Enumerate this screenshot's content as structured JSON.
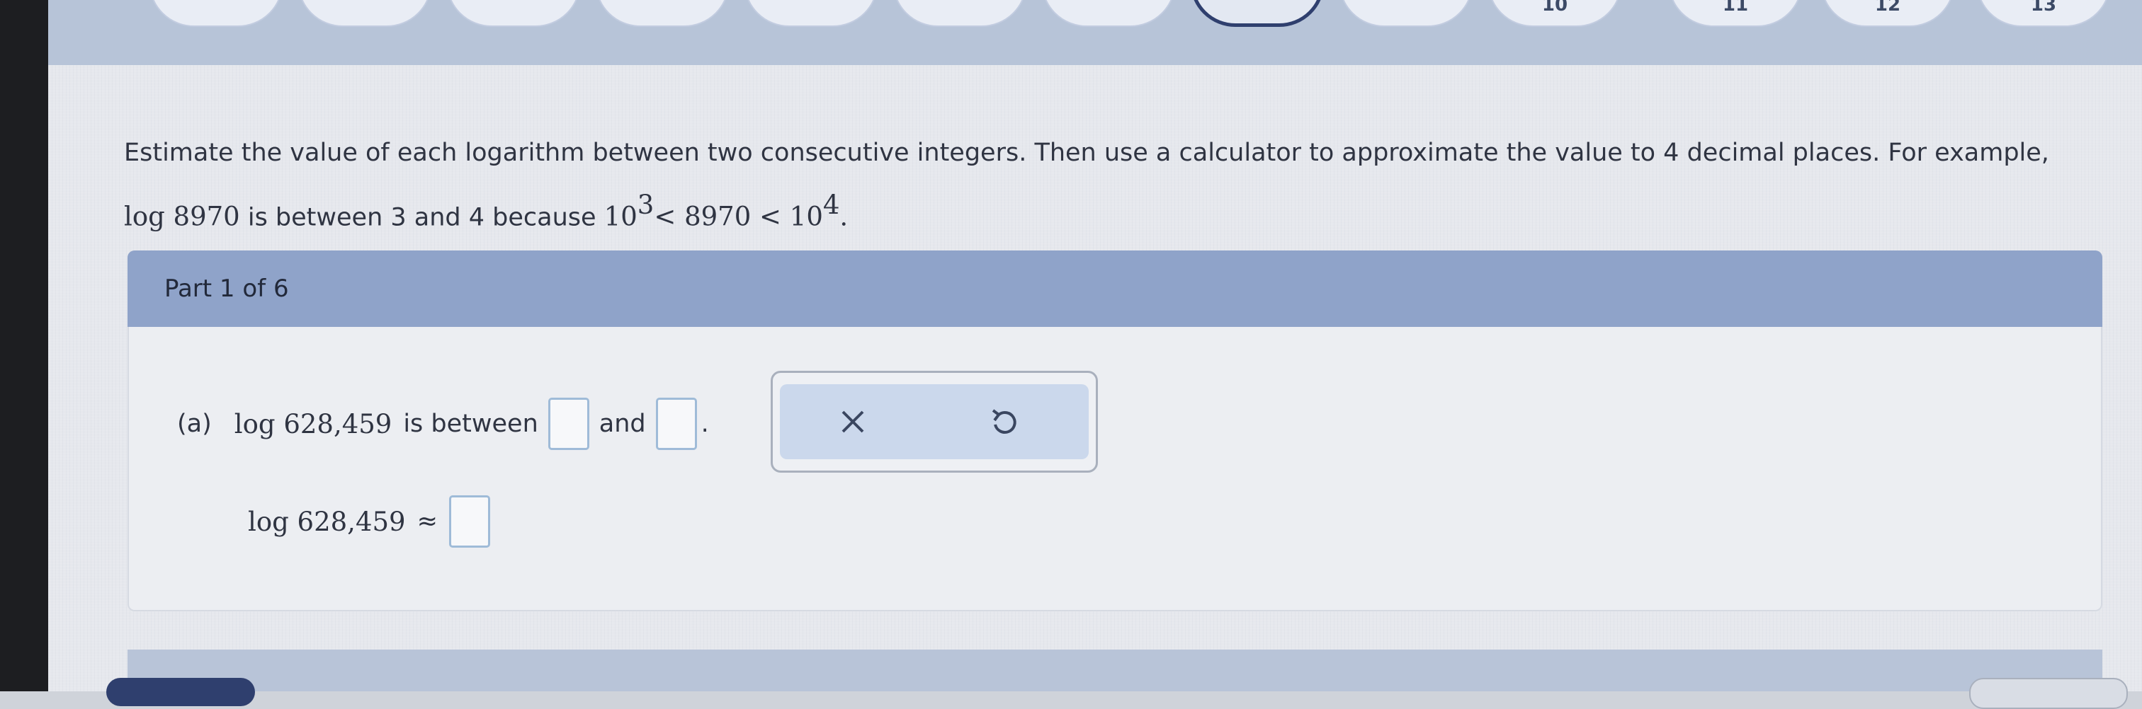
{
  "top_nav": {
    "tabs": [
      "",
      "",
      "",
      "",
      "",
      "",
      "",
      "",
      "",
      "10",
      "11",
      "12",
      "13"
    ]
  },
  "intro": {
    "line1": "Estimate the value of each logarithm between two consecutive integers. Then use a calculator to approximate the value to 4 decimal places. For example,",
    "line2_math1": "log 8970",
    "line2_text1": " is between 3 and 4 because ",
    "line2_base1": "10",
    "line2_exp1": "3",
    "line2_mid": "< 8970 < ",
    "line2_base2": "10",
    "line2_exp2": "4",
    "line2_end": "."
  },
  "part": {
    "label": "Part 1 of 6"
  },
  "question": {
    "prefix": "(a)",
    "expression": "log 628,459",
    "between": "is between",
    "and": "and",
    "period": ".",
    "approx_expression": "log 628,459",
    "approx_symbol": "≈"
  },
  "tools": {
    "clear_icon": "x-icon",
    "undo_icon": "undo-icon"
  },
  "colors": {
    "header": "#8fa3c9",
    "input_border": "#9fbbd8",
    "tool_bg": "#cbd8ec",
    "current_tab_border": "#2f3f6e"
  }
}
